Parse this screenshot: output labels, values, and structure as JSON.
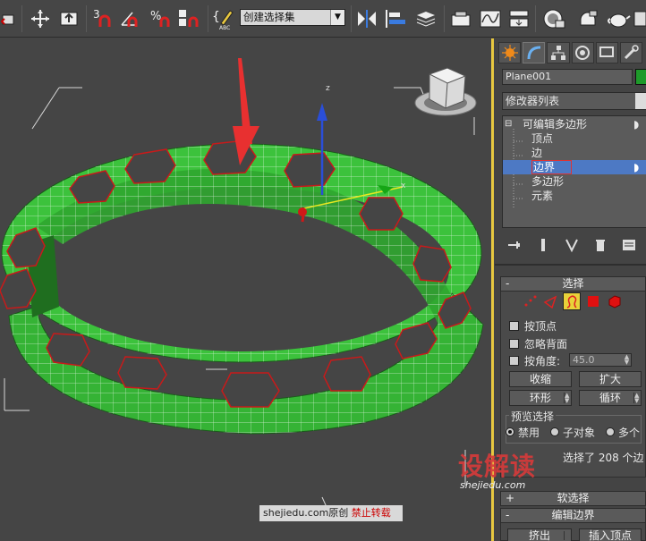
{
  "toolbar": {
    "named_selection_set": "创建选择集",
    "icons": [
      "undo-icon",
      "select-move-icon",
      "select-object-icon",
      "snaps-3d-icon",
      "angle-snap-icon",
      "percent-snap-icon",
      "spinner-snap-icon",
      "edit-named-sets-icon",
      "mirror-icon",
      "align-icon",
      "layer-manager-icon",
      "render-setup-icon",
      "curve-editor-icon",
      "schematic-view-icon",
      "material-editor-icon",
      "render-icon",
      "teapot-icon"
    ]
  },
  "viewport": {
    "gizmo_axes": {
      "z": "z",
      "x": "x"
    },
    "watermark_site": "shejiedu.com原创",
    "watermark_warn": "禁止转载"
  },
  "panel": {
    "object_name": "Plane001",
    "object_color": "#1e9a2a",
    "modifier_list": "修改器列表",
    "stack": {
      "root": "可编辑多边形",
      "items": [
        "顶点",
        "边",
        "边界",
        "多边形",
        "元素"
      ],
      "selected_index": 2
    },
    "selection_rollout": {
      "title": "选择",
      "by_vertex": "按顶点",
      "ignore_backfacing": "忽略背面",
      "by_angle": "按角度:",
      "angle_value": "45.0",
      "shrink": "收缩",
      "grow": "扩大",
      "ring": "环形",
      "loop": "循环",
      "preview_selection": "预览选择",
      "preview_off": "禁用",
      "preview_subobject": "子对象",
      "preview_multi": "多个",
      "status": "选择了 208 个边"
    },
    "soft_selection": "软选择",
    "edit_borders": "编辑边界",
    "extrude": "挤出",
    "insert_vertex": "插入顶点",
    "brand_name": "设解读",
    "brand_url": "shejiedu.com"
  },
  "colors": {
    "mesh_green": "#3cc23c",
    "selection_red": "#d01818",
    "stack_selected": "#4d79c4",
    "active_button": "#e8d23a"
  }
}
